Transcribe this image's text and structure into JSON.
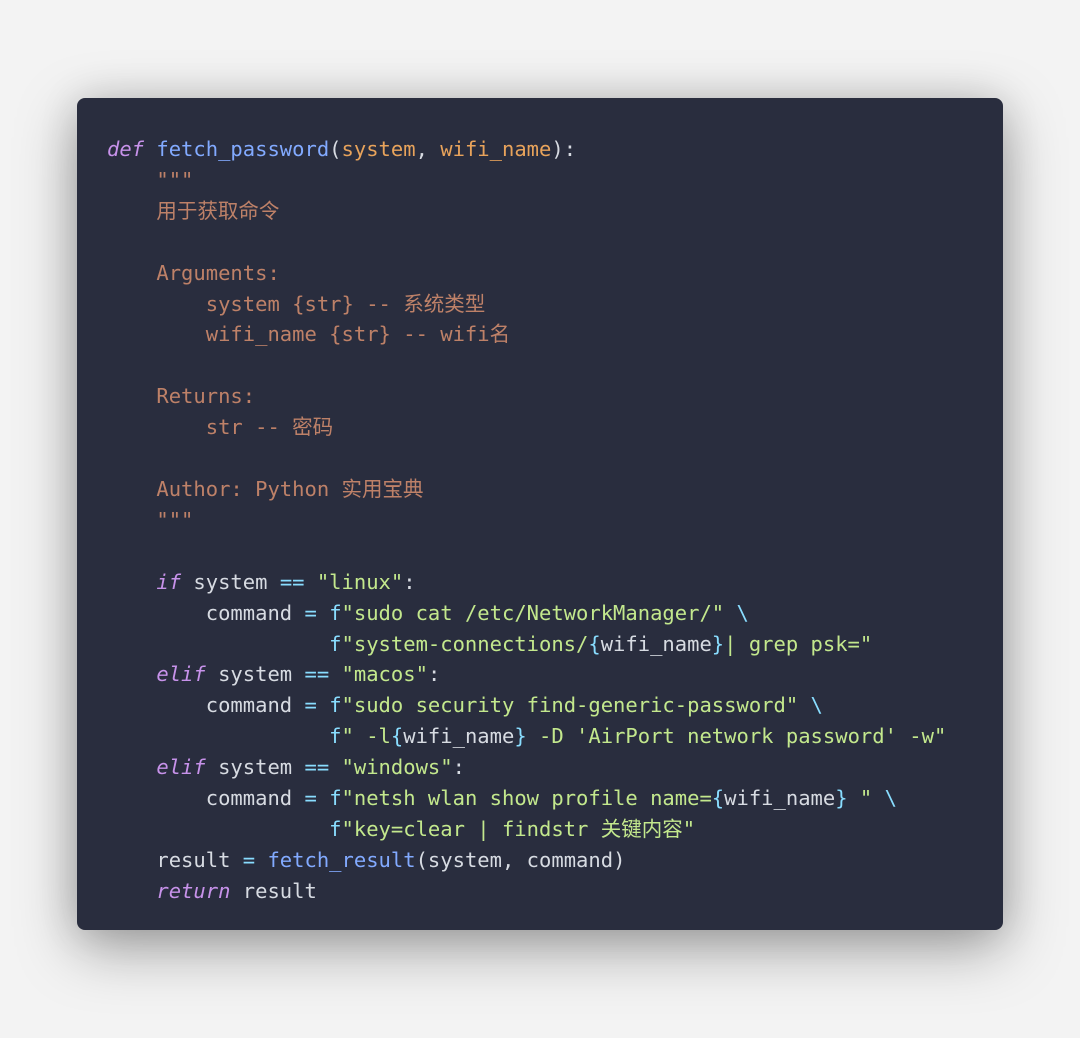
{
  "colors": {
    "bg": "#292d3e",
    "page": "#f3f3f3"
  },
  "code": {
    "def_kw": "def",
    "fn_name": "fetch_password",
    "args": {
      "system": "system",
      "wifi": "wifi_name"
    },
    "triple": "\"\"\"",
    "doc": {
      "desc": "用于获取命令",
      "arguments_hdr": "Arguments:",
      "arg1": "system {str} -- 系统类型",
      "arg2": "wifi_name {str} -- wifi名",
      "returns_hdr": "Returns:",
      "ret1": "str -- 密码",
      "author": "Author: Python 实用宝典"
    },
    "kw": {
      "if": "if",
      "elif": "elif",
      "return": "return"
    },
    "ids": {
      "system": "system",
      "command": "command",
      "result": "result",
      "wifi_name": "wifi_name"
    },
    "fns": {
      "fetch_result": "fetch_result"
    },
    "ops": {
      "eq": "==",
      "assign": "="
    },
    "f": "f",
    "bslash": "\\",
    "strings": {
      "linux": "\"linux\"",
      "macos": "\"macos\"",
      "windows": "\"windows\"",
      "s_linux_a": "\"sudo cat /etc/NetworkManager/\"",
      "s_linux_b_open": "\"system-connections/",
      "s_linux_b_close": "| grep psk=\"",
      "s_macos_a": "\"sudo security find-generic-password\"",
      "s_macos_b_open": "\" -l",
      "s_macos_b_close": " -D 'AirPort network password' -w\"",
      "s_win_a_open": "\"netsh wlan show profile name=",
      "s_win_a_close": " \"",
      "s_win_b": "\"key=clear | findstr 关键内容\""
    },
    "braces": {
      "open": "{",
      "close": "}"
    },
    "punct": {
      "lparen": "(",
      "rparen": ")",
      "comma": ",",
      "colon": ":"
    }
  }
}
